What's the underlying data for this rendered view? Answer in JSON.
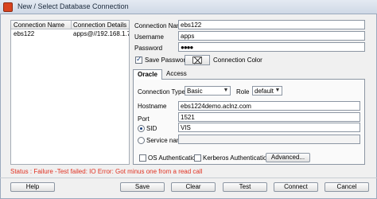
{
  "window": {
    "title": "New / Select Database Connection"
  },
  "connection_list": {
    "headers": [
      "Connection Name",
      "Connection Details"
    ],
    "rows": [
      {
        "name": "ebs122",
        "details": "apps@//192.168.1.7..."
      }
    ]
  },
  "form": {
    "connection_name": {
      "label": "Connection Name",
      "value": "ebs122"
    },
    "username": {
      "label": "Username",
      "value": "apps"
    },
    "password": {
      "label": "Password",
      "value": "●●●●"
    },
    "save_password": {
      "label": "Save Password",
      "checked": true
    },
    "connection_color": {
      "label": "Connection Color"
    }
  },
  "tabs": [
    {
      "label": "Oracle",
      "active": true
    },
    {
      "label": "Access",
      "active": false
    }
  ],
  "oracle": {
    "connection_type": {
      "label": "Connection Type",
      "value": "Basic"
    },
    "role": {
      "label": "Role",
      "value": "default"
    },
    "hostname": {
      "label": "Hostname",
      "value": "ebs1224demo.aclnz.com"
    },
    "port": {
      "label": "Port",
      "value": "1521"
    },
    "sid": {
      "label": "SID",
      "value": "VIS",
      "selected": true
    },
    "service_name": {
      "label": "Service name",
      "value": "",
      "selected": false
    },
    "os_auth": {
      "label": "OS Authentication",
      "checked": false
    },
    "kerberos_auth": {
      "label": "Kerberos Authentication",
      "checked": false
    },
    "advanced_label": "Advanced..."
  },
  "status": {
    "text": "Status : Failure -Test failed: IO Error: Got minus one from a read call",
    "color": "#e03121"
  },
  "buttons": {
    "help": "Help",
    "save": "Save",
    "clear": "Clear",
    "test": "Test",
    "connect": "Connect",
    "cancel": "Cancel"
  }
}
